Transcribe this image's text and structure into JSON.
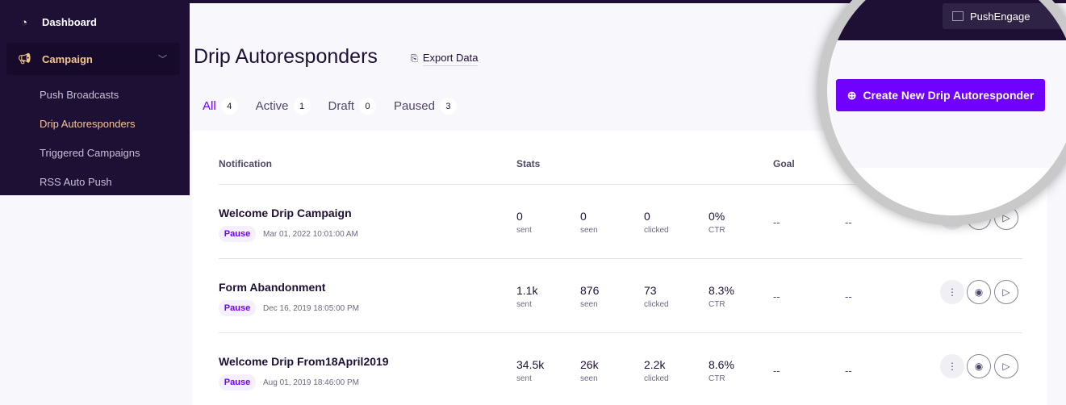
{
  "sidebar": {
    "dashboard": "Dashboard",
    "campaign": "Campaign",
    "items": [
      "Push Broadcasts",
      "Drip Autoresponders",
      "Triggered Campaigns",
      "RSS Auto Push"
    ]
  },
  "header": {
    "title": "Drip Autoresponders",
    "export": "Export Data",
    "account": "PushEngage",
    "create": "Create New Drip Autoresponder"
  },
  "tabs": [
    {
      "label": "All",
      "count": "4"
    },
    {
      "label": "Active",
      "count": "1"
    },
    {
      "label": "Draft",
      "count": "0"
    },
    {
      "label": "Paused",
      "count": "3"
    }
  ],
  "table": {
    "headers": {
      "notification": "Notification",
      "stats": "Stats",
      "goal": "Goal"
    },
    "stat_labels": [
      "sent",
      "seen",
      "clicked",
      "CTR"
    ],
    "rows": [
      {
        "name": "Welcome Drip Campaign",
        "status": "Pause",
        "date": "Mar 01, 2022 10:01:00 AM",
        "stats": [
          "0",
          "0",
          "0",
          "0%"
        ],
        "goal1": "--",
        "goal2": "--"
      },
      {
        "name": "Form Abandonment",
        "status": "Pause",
        "date": "Dec 16, 2019 18:05:00 PM",
        "stats": [
          "1.1k",
          "876",
          "73",
          "8.3%"
        ],
        "goal1": "--",
        "goal2": "--"
      },
      {
        "name": "Welcome Drip From18April2019",
        "status": "Pause",
        "date": "Aug 01, 2019 18:46:00 PM",
        "stats": [
          "34.5k",
          "26k",
          "2.2k",
          "8.6%"
        ],
        "goal1": "--",
        "goal2": "--"
      }
    ]
  },
  "colors": {
    "accent": "#7000ff",
    "sidebar": "#1e1035",
    "highlight": "#f6c58f"
  }
}
